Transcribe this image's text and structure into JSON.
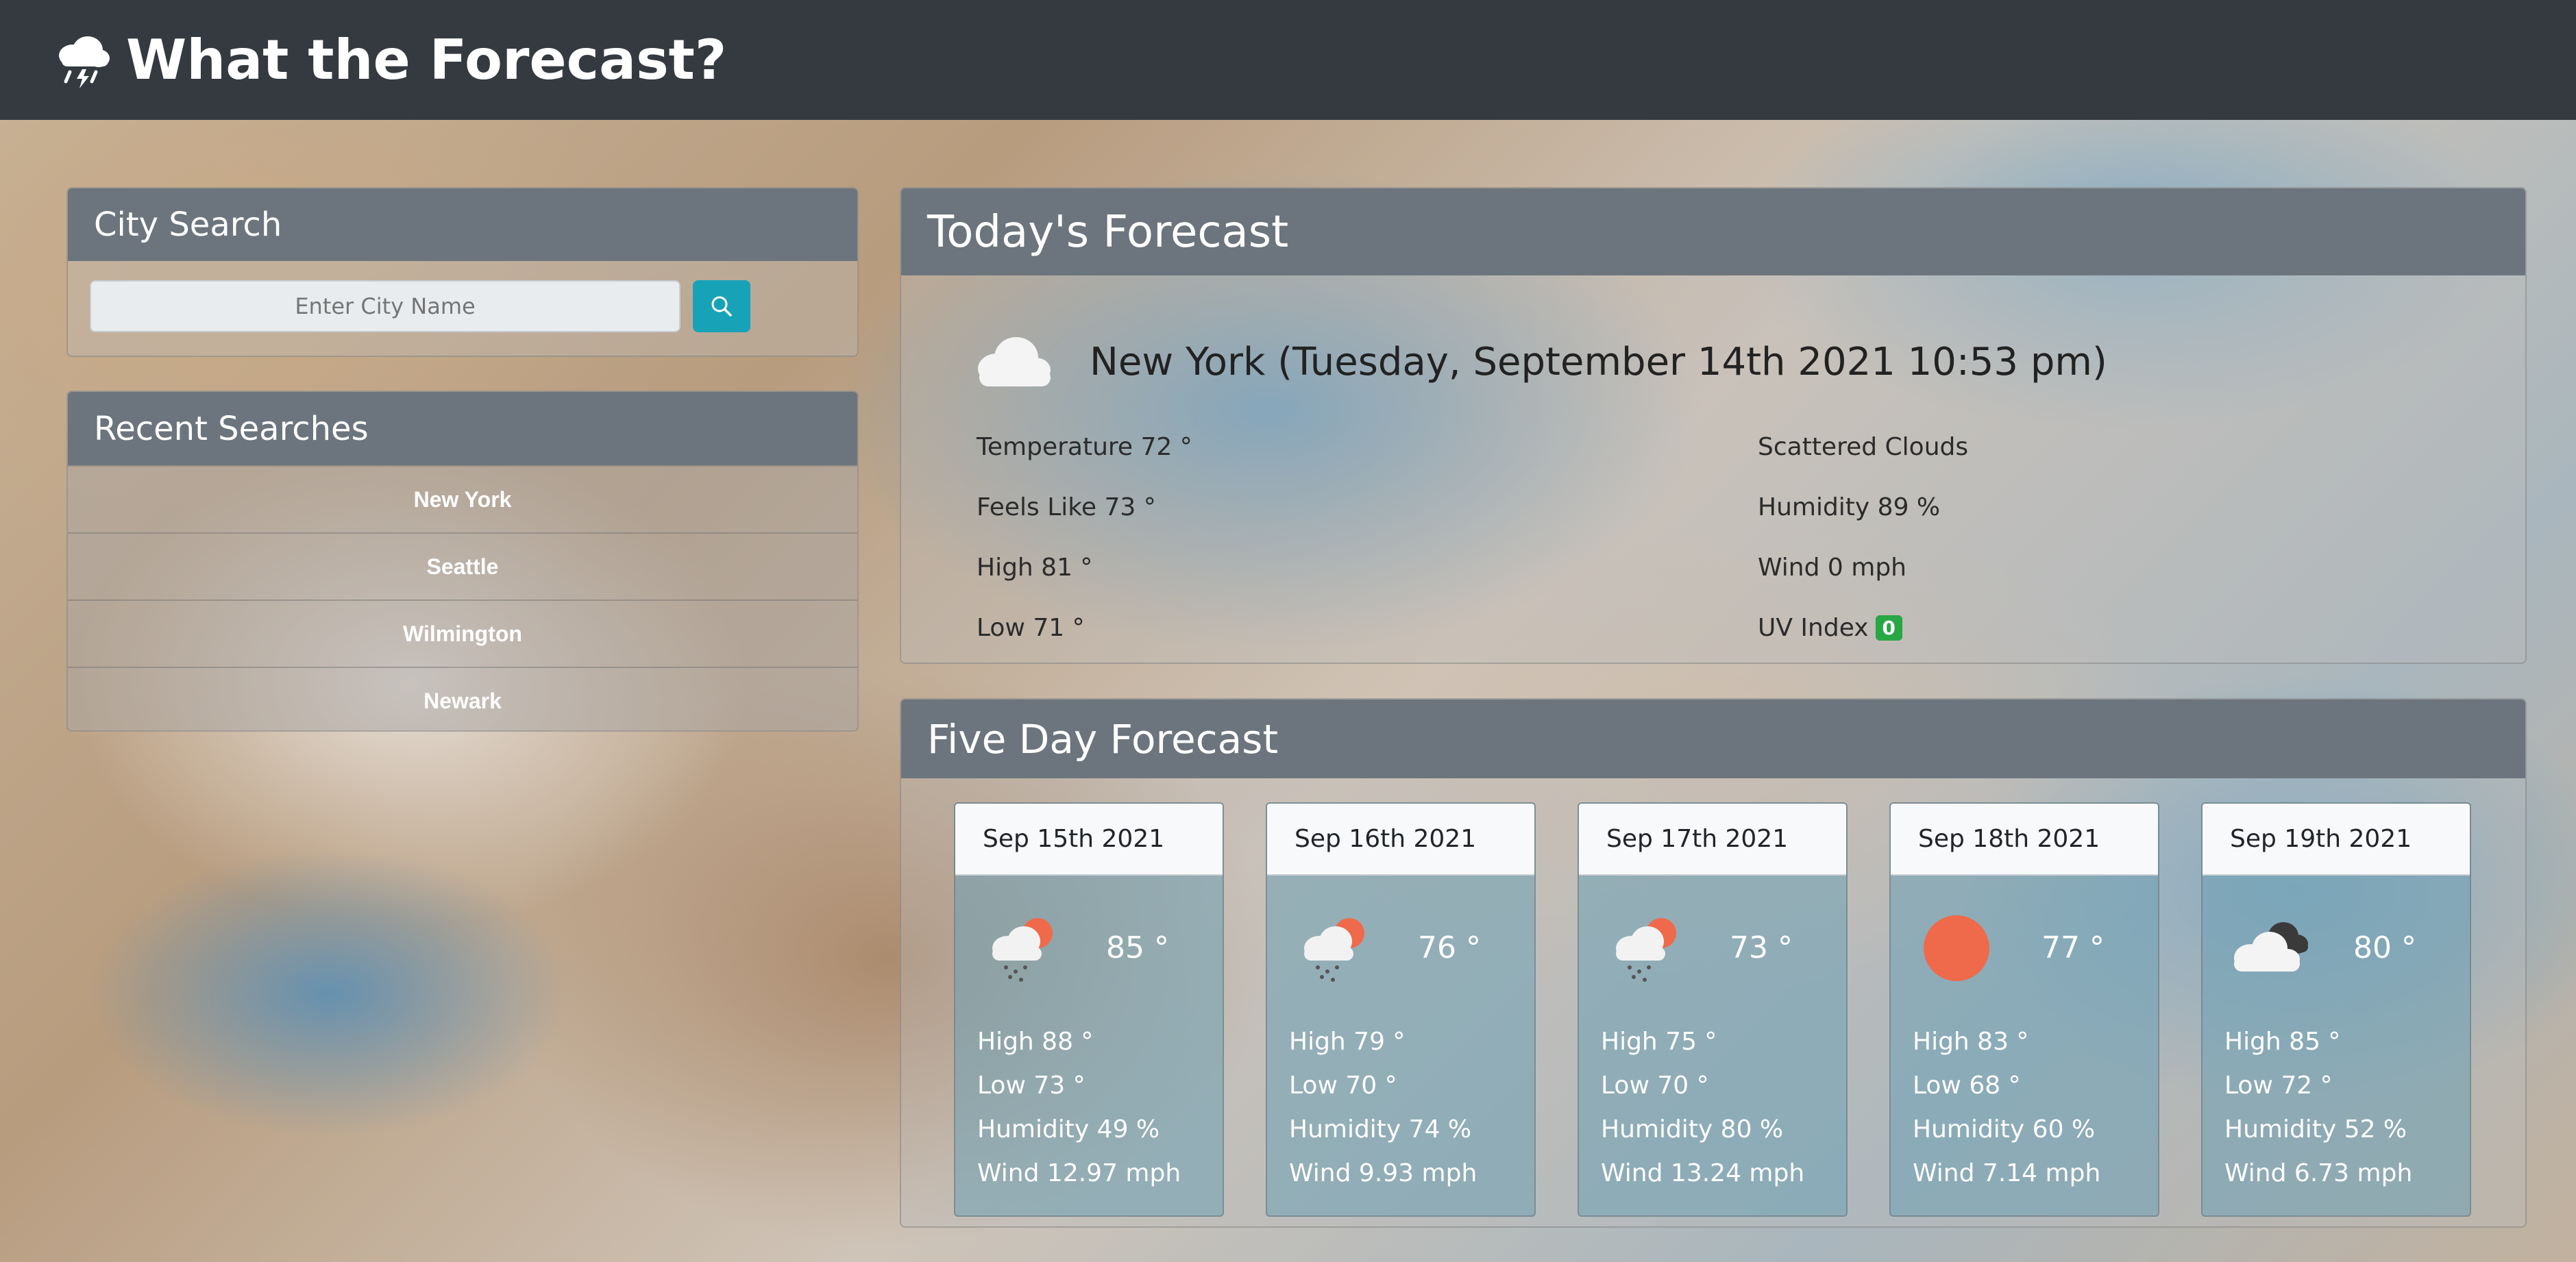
{
  "header": {
    "title": "What the Forecast?",
    "icon": "rain-cloud-icon"
  },
  "city_search": {
    "title": "City Search",
    "placeholder": "Enter City Name",
    "button_icon": "search-icon"
  },
  "recent": {
    "title": "Recent Searches",
    "items": [
      {
        "label": "New York"
      },
      {
        "label": "Seattle"
      },
      {
        "label": "Wilmington"
      },
      {
        "label": "Newark"
      }
    ]
  },
  "today": {
    "title": "Today's Forecast",
    "icon": "cloud-icon",
    "heading": "New York (Tuesday, September 14th 2021 10:53 pm)",
    "temperature": "Temperature 72 °",
    "feels_like": "Feels Like 73 °",
    "high": "High 81 °",
    "low": "Low 71 °",
    "description": "Scattered Clouds",
    "humidity": "Humidity 89 %",
    "wind": "Wind 0 mph",
    "uv_label": "UV Index",
    "uv_value": "0",
    "uv_color": "#28a745"
  },
  "five_day": {
    "title": "Five Day Forecast",
    "days": [
      {
        "date": "Sep 15th 2021",
        "icon": "rain-sun-icon",
        "temp": "85 °",
        "high": "High 88 °",
        "low": "Low 73 °",
        "humidity": "Humidity 49 %",
        "wind": "Wind 12.97 mph"
      },
      {
        "date": "Sep 16th 2021",
        "icon": "rain-sun-icon",
        "temp": "76 °",
        "high": "High 79 °",
        "low": "Low 70 °",
        "humidity": "Humidity 74 %",
        "wind": "Wind 9.93 mph"
      },
      {
        "date": "Sep 17th 2021",
        "icon": "rain-sun-icon",
        "temp": "73 °",
        "high": "High 75 °",
        "low": "Low 70 °",
        "humidity": "Humidity 80 %",
        "wind": "Wind 13.24 mph"
      },
      {
        "date": "Sep 18th 2021",
        "icon": "sun-icon",
        "temp": "77 °",
        "high": "High 83 °",
        "low": "Low 68 °",
        "humidity": "Humidity 60 %",
        "wind": "Wind 7.14 mph"
      },
      {
        "date": "Sep 19th 2021",
        "icon": "dark-clouds-icon",
        "temp": "80 °",
        "high": "High 85 °",
        "low": "Low 72 °",
        "humidity": "Humidity 52 %",
        "wind": "Wind 6.73 mph"
      }
    ]
  },
  "colors": {
    "navbar": "#343a40",
    "card_header": "#6c757d",
    "search_button": "#17a2b8",
    "sun": "#ef6a4a"
  }
}
